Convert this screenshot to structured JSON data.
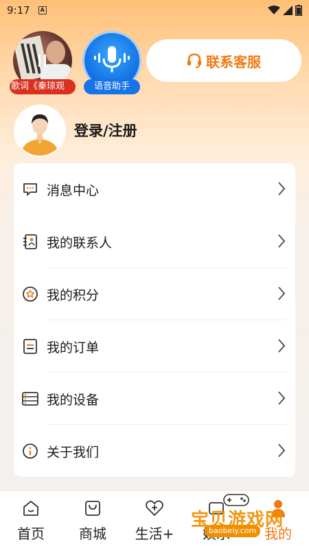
{
  "status_bar": {
    "time": "9:17",
    "notification_badge": "A"
  },
  "video_card": {
    "label": "歌词《秦琼观"
  },
  "voice_card": {
    "label": "语音助手"
  },
  "service_button": {
    "label": "联系客服"
  },
  "login": {
    "label": "登录/注册"
  },
  "menu": {
    "items": [
      {
        "label": "消息中心",
        "icon": "message-icon"
      },
      {
        "label": "我的联系人",
        "icon": "contacts-icon"
      },
      {
        "label": "我的积分",
        "icon": "points-icon"
      },
      {
        "label": "我的订单",
        "icon": "order-icon"
      },
      {
        "label": "我的设备",
        "icon": "device-icon"
      },
      {
        "label": "关于我们",
        "icon": "info-icon"
      }
    ]
  },
  "bottom_nav": {
    "items": [
      {
        "label": "首页",
        "icon": "home-icon"
      },
      {
        "label": "商城",
        "icon": "shop-bag-icon"
      },
      {
        "label": "生活+",
        "icon": "heart-plus-icon"
      },
      {
        "label": "娱乐",
        "icon": "entertainment-icon"
      },
      {
        "label": "我的",
        "icon": "profile-icon"
      }
    ]
  },
  "watermark": {
    "text": "宝贝游戏网",
    "url": "baobeiy.com"
  },
  "colors": {
    "accent": "#f07a12",
    "voice_blue": "#1773e8",
    "video_red": "#d9301f"
  }
}
